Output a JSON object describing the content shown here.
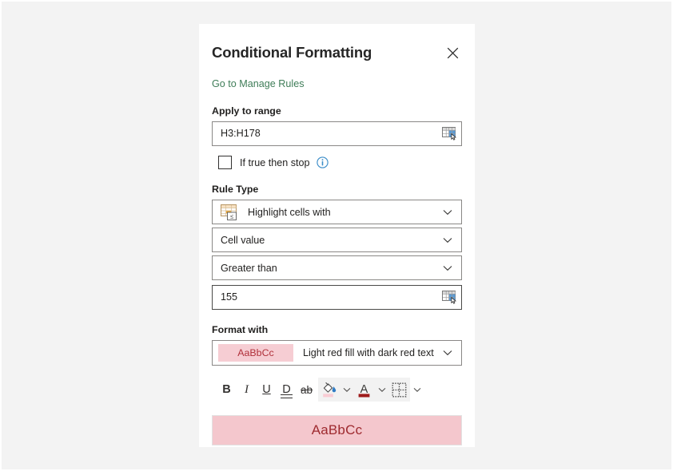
{
  "panel": {
    "title": "Conditional Formatting",
    "close_icon": "close-icon",
    "manage_rules_link": "Go to Manage Rules",
    "link_color": "#3f7d58"
  },
  "apply_to_range": {
    "label": "Apply to range",
    "value": "H3:H178",
    "placeholder": "",
    "picker_icon": "range-picker-icon"
  },
  "if_true_then_stop": {
    "label": "If true then stop",
    "checked": false,
    "info_icon": "info-icon"
  },
  "rule_type": {
    "label": "Rule Type",
    "dropdowns": [
      {
        "value": "Highlight cells with",
        "icon": "highlight-cells-icon",
        "chevron": "chevron-down-icon"
      },
      {
        "value": "Cell value",
        "icon": "",
        "chevron": "chevron-down-icon"
      },
      {
        "value": "Greater than",
        "icon": "",
        "chevron": "chevron-down-icon"
      }
    ],
    "threshold_value": "155",
    "threshold_picker_icon": "range-picker-icon"
  },
  "format_with": {
    "label": "Format with",
    "swatch_text": "AaBbCc",
    "swatch_bg": "#f6cdd3",
    "swatch_fg": "#b0303a",
    "value": "Light red fill with dark red text",
    "chevron": "chevron-down-icon"
  },
  "toolbar": {
    "bold": "B",
    "italic": "I",
    "underline": "U",
    "double_underline": "D",
    "strikethrough": "ab",
    "fill_color_icon": "fill-color-icon",
    "fill_color": "#f9ccd4",
    "font_color_icon": "font-color-icon",
    "font_color": "#9e1b1b",
    "borders_icon": "borders-icon",
    "chevron": "chevron-down-icon"
  },
  "preview": {
    "text": "AaBbCc",
    "background": "#f4c7cd",
    "color": "#9e2a2f"
  }
}
